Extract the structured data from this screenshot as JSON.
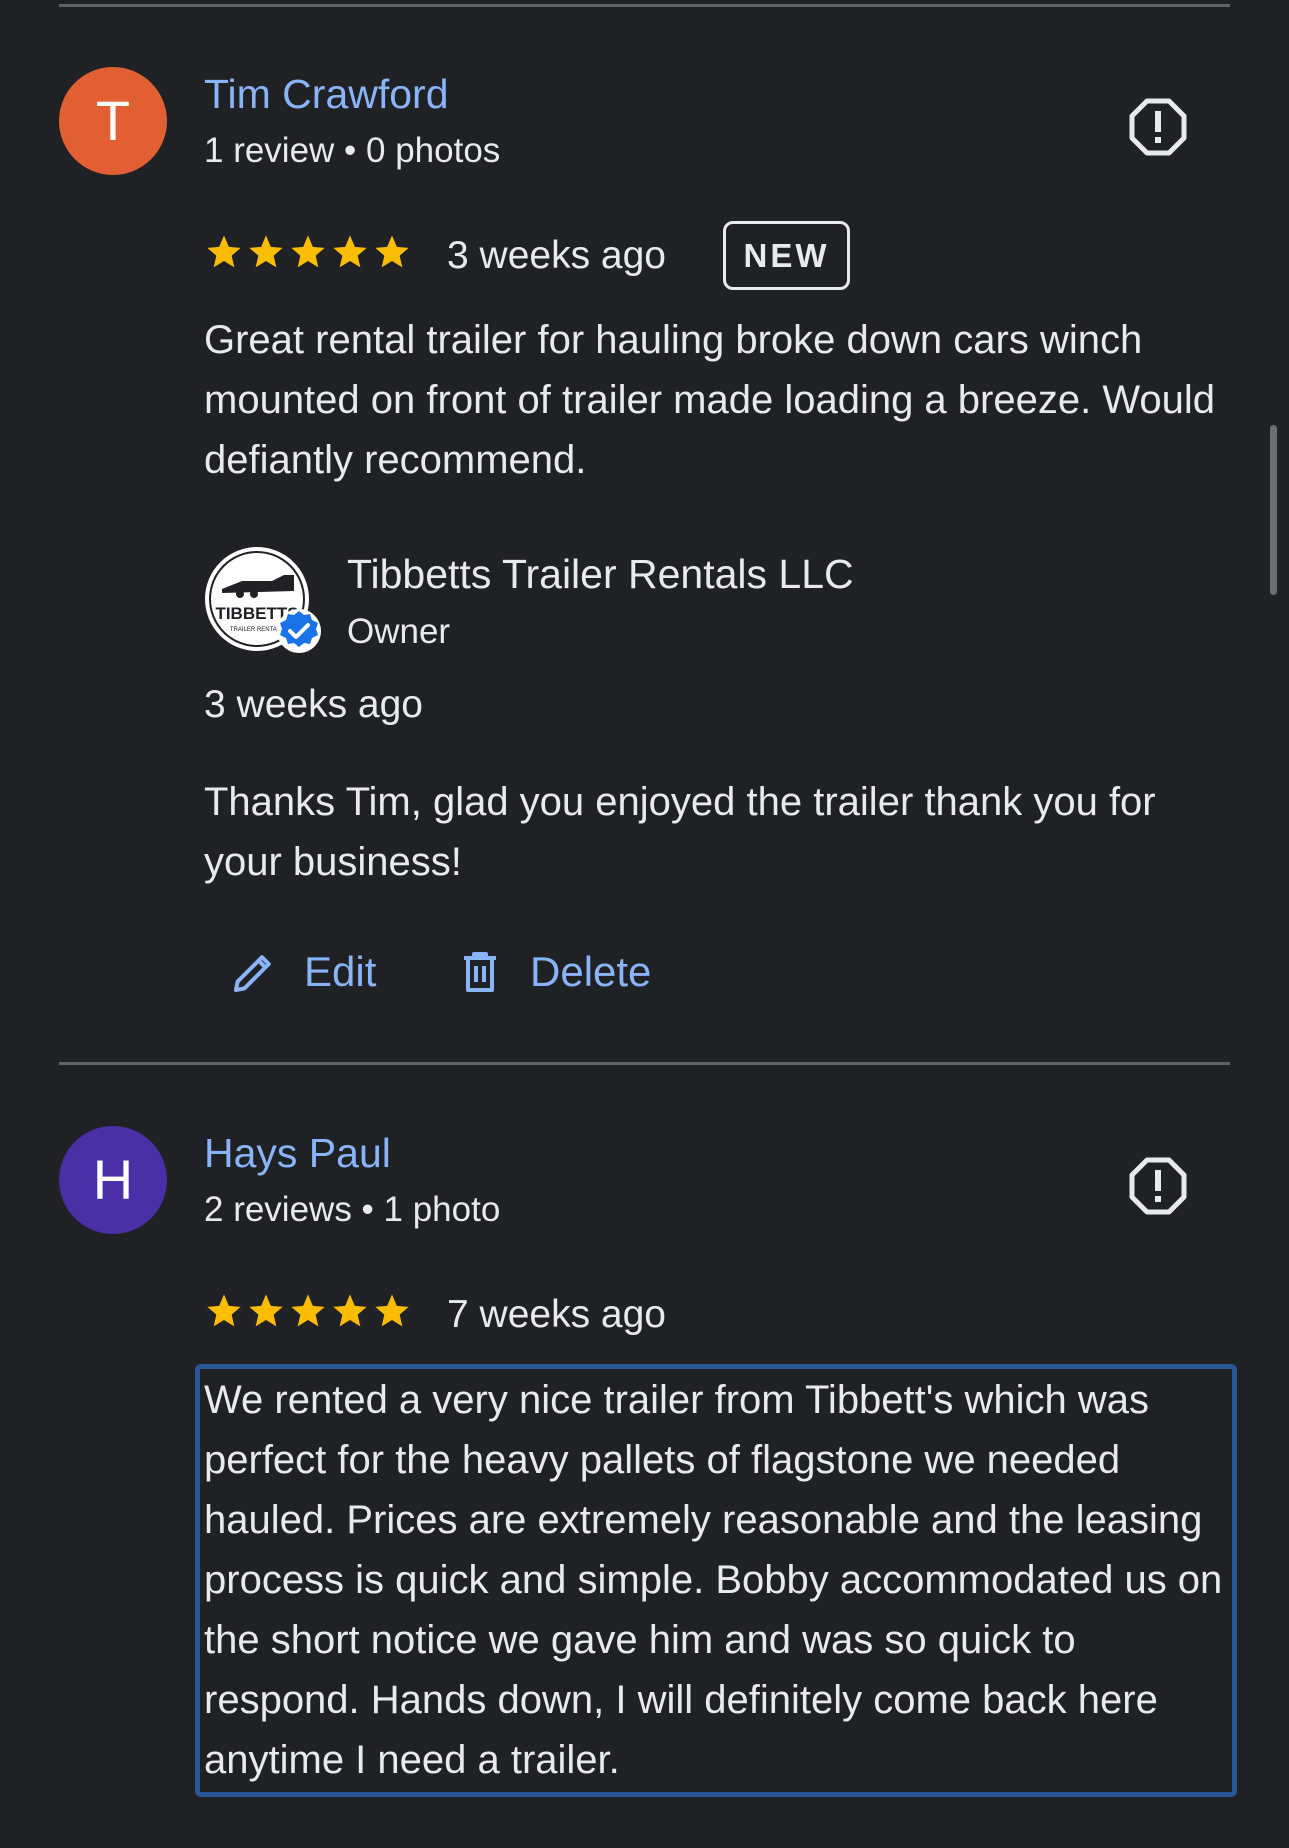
{
  "colors": {
    "background": "#202124",
    "link": "#8ab4f8",
    "text": "#e8eaed",
    "star": "#fbbc04",
    "divider": "#5f6368",
    "highlight": "#2b5797",
    "verified": "#1a73e8"
  },
  "reviews": [
    {
      "avatar_letter": "T",
      "avatar_color": "#e25f34",
      "name": "Tim Crawford",
      "meta": "1 review • 0 photos",
      "rating": 5,
      "time": "3 weeks ago",
      "badge": "NEW",
      "text": "Great rental trailer for hauling broke down cars winch mounted on front of trailer made loading a breeze. Would defiantly recommend.",
      "owner_reply": {
        "logo_text": "TIBBETTS",
        "logo_subtext": "TRAILER RENTALS",
        "name": "Tibbetts Trailer Rentals LLC",
        "role": "Owner",
        "time": "3 weeks ago",
        "text": "Thanks Tim, glad you enjoyed the trailer thank you for your business!",
        "actions": {
          "edit": "Edit",
          "delete": "Delete"
        }
      }
    },
    {
      "avatar_letter": "H",
      "avatar_color": "#4a2fa6",
      "name": "Hays Paul",
      "meta": "2 reviews • 1 photo",
      "rating": 5,
      "time": "7 weeks ago",
      "text": "We rented a very nice trailer from Tibbett's which was perfect for the heavy pallets of flagstone we needed hauled. Prices are extremely reasonable and the leasing process is quick and simple. Bobby accommodated us on the short notice we gave him and was so quick to respond. Hands down, I will definitely come back here anytime I need a trailer."
    }
  ],
  "icons": {
    "flag": "report-icon",
    "star": "star-icon",
    "edit": "pencil-icon",
    "delete": "trash-icon",
    "verified": "verified-check-icon"
  }
}
